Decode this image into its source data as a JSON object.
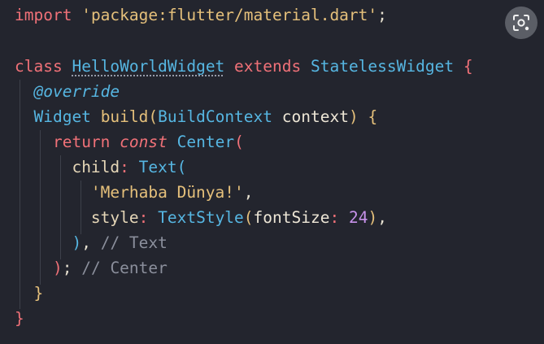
{
  "code": {
    "l1": {
      "kw_import": "import",
      "str_pkg": "'package:flutter/material.dart'",
      "semi": ";"
    },
    "l3": {
      "kw_class": "class",
      "class_name": "HelloWorldWidget",
      "kw_extends": "extends",
      "base_class": "StatelessWidget",
      "open_brace": "{"
    },
    "l4": {
      "annotation": "@override"
    },
    "l5": {
      "type": "Widget",
      "method": "build",
      "open_paren": "(",
      "param_type": "BuildContext",
      "param_name": "context",
      "close_paren": ")",
      "open_brace": "{"
    },
    "l6": {
      "kw_return": "return",
      "kw_const": "const",
      "ctor": "Center",
      "open_paren": "("
    },
    "l7": {
      "prop": "child",
      "colon": ":",
      "ctor": "Text",
      "open_paren": "("
    },
    "l8": {
      "str": "'Merhaba Dünya!'",
      "comma": ","
    },
    "l9": {
      "prop": "style",
      "colon": ":",
      "ctor": "TextStyle",
      "open_paren": "(",
      "named_arg": "fontSize",
      "colon2": ":",
      "num": "24",
      "close_paren": ")",
      "comma": ","
    },
    "l10": {
      "close_paren": ")",
      "comma": ",",
      "comment": "// Text"
    },
    "l11": {
      "close_paren": ")",
      "semi": ";",
      "comment": "// Center"
    },
    "l12": {
      "close_brace": "}"
    },
    "l13": {
      "close_brace": "}"
    }
  },
  "lens_button": {
    "icon": "lens-scan-icon"
  }
}
